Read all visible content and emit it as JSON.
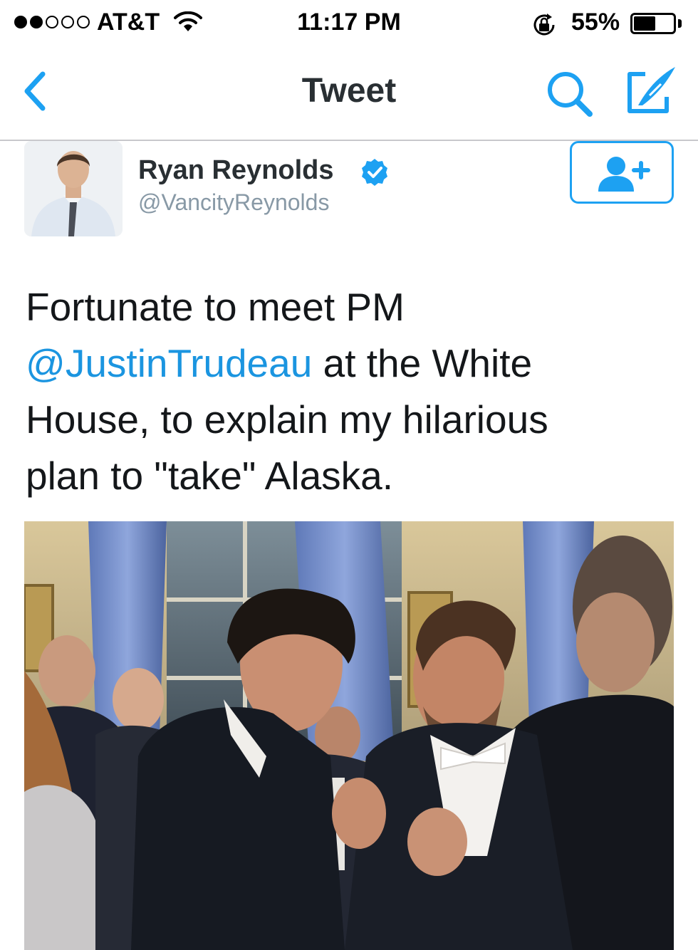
{
  "status_bar": {
    "signal_dots_filled": 2,
    "signal_dots_total": 5,
    "carrier": "AT&T",
    "time": "11:17 PM",
    "battery_percent": "55%",
    "battery_level": 0.55,
    "icons": [
      "wifi-icon",
      "rotation-lock-icon",
      "battery-icon"
    ]
  },
  "nav": {
    "title": "Tweet",
    "icons": [
      "back-chevron-icon",
      "search-icon",
      "compose-icon"
    ],
    "accent_color": "#1da1f2"
  },
  "tweet": {
    "author_name": "Ryan Reynolds",
    "author_handle": "@VancityReynolds",
    "verified": true,
    "follow_icon": "follow-user-plus-icon",
    "text_lines": [
      {
        "before": "Fortunate to meet PM",
        "mention": "",
        "after": ""
      },
      {
        "before": "",
        "mention": "@JustinTrudeau",
        "after": " at the White"
      },
      {
        "before": "House, to explain my hilarious",
        "mention": "",
        "after": ""
      },
      {
        "before": "plan to \"take\" Alaska.",
        "mention": "",
        "after": ""
      }
    ],
    "mention_color": "#1b95e0"
  }
}
